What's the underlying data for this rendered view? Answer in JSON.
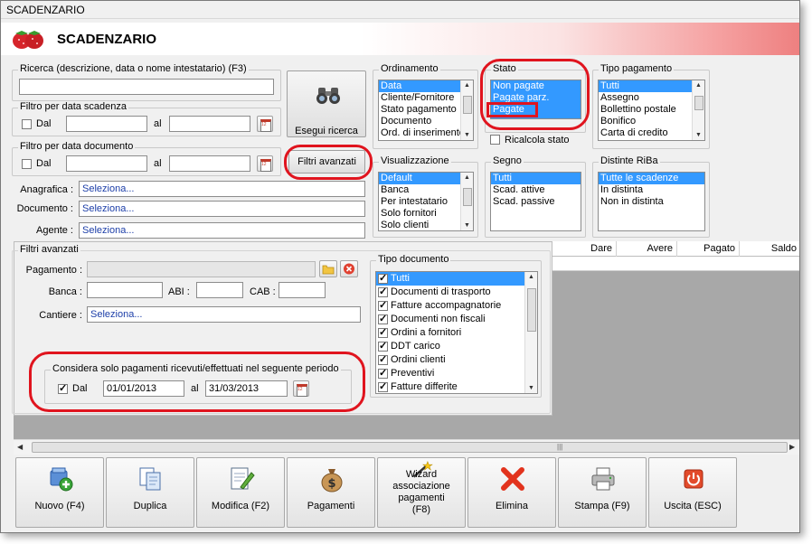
{
  "window": {
    "title": "SCADENZARIO"
  },
  "header": {
    "title": "SCADENZARIO"
  },
  "search": {
    "label": "Ricerca (descrizione, data o nome intestatario) (F3)",
    "value": ""
  },
  "filter_scadenza": {
    "label": "Filtro per data scadenza",
    "dal_label": "Dal",
    "al_label": "al",
    "from": "",
    "to": ""
  },
  "filter_documento": {
    "label": "Filtro per data documento",
    "dal_label": "Dal",
    "al_label": "al",
    "from": "",
    "to": ""
  },
  "buttons": {
    "esegui_ricerca": "Esegui ricerca",
    "filtri_avanzati": "Filtri avanzati"
  },
  "fields": {
    "anagrafica_label": "Anagrafica :",
    "anagrafica_value": "Seleziona...",
    "documento_label": "Documento :",
    "documento_value": "Seleziona...",
    "agente_label": "Agente :",
    "agente_value": "Seleziona..."
  },
  "ordinamento": {
    "label": "Ordinamento",
    "items": [
      "Data",
      "Cliente/Fornitore",
      "Stato pagamento",
      "Documento",
      "Ord. di inserimento"
    ],
    "selected": 0
  },
  "stato": {
    "label": "Stato",
    "items": [
      "Non pagate",
      "Pagate parz.",
      "Pagate"
    ],
    "ricalcola_label": "Ricalcola stato"
  },
  "tipo_pagamento": {
    "label": "Tipo pagamento",
    "items": [
      "Tutti",
      "Assegno",
      "Bollettino postale",
      "Bonifico",
      "Carta di credito"
    ],
    "selected": 0
  },
  "visualizzazione": {
    "label": "Visualizzazione",
    "items": [
      "Default",
      "Banca",
      "Per intestatario",
      "Solo fornitori",
      "Solo clienti"
    ],
    "selected": 0
  },
  "segno": {
    "label": "Segno",
    "items": [
      "Tutti",
      "Scad. attive",
      "Scad. passive"
    ],
    "selected": 0
  },
  "distinte_riba": {
    "label": "Distinte RiBa",
    "items": [
      "Tutte le scadenze",
      "In distinta",
      "Non in distinta"
    ],
    "selected": 0
  },
  "filtri_avanzati": {
    "label": "Filtri avanzati",
    "pagamento_label": "Pagamento :",
    "banca_label": "Banca :",
    "abi_label": "ABI :",
    "cab_label": "CAB :",
    "cantiere_label": "Cantiere :",
    "cantiere_value": "Seleziona...",
    "periodo_label": "Considera solo pagamenti ricevuti/effettuati nel seguente periodo",
    "dal_label": "Dal",
    "al_label": "al",
    "from": "01/01/2013",
    "to": "31/03/2013"
  },
  "tipo_documento": {
    "label": "Tipo documento",
    "items": [
      "Tutti",
      "Documenti di trasporto",
      "Fatture accompagnatorie",
      "Documenti non fiscali",
      "Ordini a fornitori",
      "DDT carico",
      "Ordini clienti",
      "Preventivi",
      "Fatture differite"
    ]
  },
  "grid": {
    "columns": [
      "Dare",
      "Avere",
      "Pagato",
      "Saldo"
    ]
  },
  "toolbar": {
    "nuovo": "Nuovo (F4)",
    "duplica": "Duplica",
    "modifica": "Modifica (F2)",
    "pagamenti": "Pagamenti",
    "wizard": "Wizard associazione pagamenti (F8)",
    "elimina": "Elimina",
    "stampa": "Stampa (F9)",
    "uscita": "Uscita (ESC)"
  },
  "colors": {
    "selection": "#3399ff",
    "highlight": "#e0141e",
    "link_text": "#1c3ea8"
  }
}
